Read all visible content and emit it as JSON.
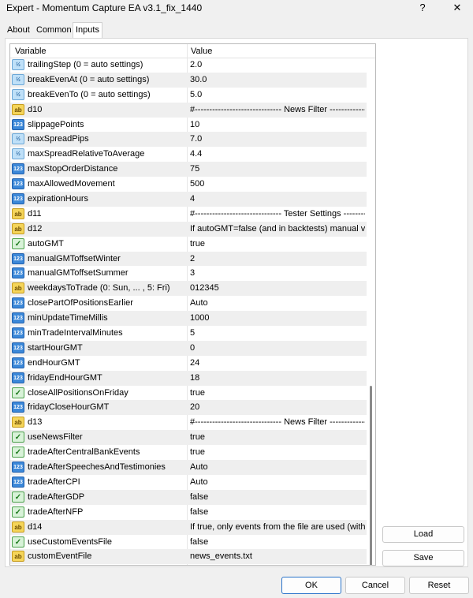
{
  "window": {
    "title": "Expert - Momentum Capture EA v3.1_fix_1440",
    "help_label": "?",
    "close_label": "✕"
  },
  "tabs": [
    {
      "label": "About"
    },
    {
      "label": "Common"
    },
    {
      "label": "Inputs"
    }
  ],
  "grid": {
    "col_variable": "Variable",
    "col_value": "Value",
    "rows": [
      {
        "name": "trailingStep (0 = auto settings)",
        "value": "2.0",
        "type": "dbl"
      },
      {
        "name": "breakEvenAt (0 = auto settings)",
        "value": "30.0",
        "type": "dbl"
      },
      {
        "name": "breakEvenTo (0 = auto settings)",
        "value": "5.0",
        "type": "dbl"
      },
      {
        "name": "d10",
        "value": "#------------------------------ News Filter ---------------------...",
        "type": "str"
      },
      {
        "name": "slippagePoints",
        "value": "10",
        "type": "num"
      },
      {
        "name": "maxSpreadPips",
        "value": "7.0",
        "type": "dbl"
      },
      {
        "name": "maxSpreadRelativeToAverage",
        "value": "4.4",
        "type": "dbl"
      },
      {
        "name": "maxStopOrderDistance",
        "value": "75",
        "type": "num"
      },
      {
        "name": "maxAllowedMovement",
        "value": "500",
        "type": "num"
      },
      {
        "name": "expirationHours",
        "value": "4",
        "type": "num"
      },
      {
        "name": "d11",
        "value": "#------------------------------ Tester Settings ------------------...",
        "type": "str"
      },
      {
        "name": "d12",
        "value": "If autoGMT=false (and in backtests) manual val...",
        "type": "str"
      },
      {
        "name": "autoGMT",
        "value": "true",
        "type": "bool"
      },
      {
        "name": "manualGMToffsetWinter",
        "value": "2",
        "type": "num"
      },
      {
        "name": "manualGMToffsetSummer",
        "value": "3",
        "type": "num"
      },
      {
        "name": "weekdaysToTrade (0: Sun, ... , 5: Fri)",
        "value": "012345",
        "type": "str"
      },
      {
        "name": "closePartOfPositionsEarlier",
        "value": "Auto",
        "type": "num"
      },
      {
        "name": "minUpdateTimeMillis",
        "value": "1000",
        "type": "num"
      },
      {
        "name": "minTradeIntervalMinutes",
        "value": "5",
        "type": "num"
      },
      {
        "name": "startHourGMT",
        "value": "0",
        "type": "num"
      },
      {
        "name": "endHourGMT",
        "value": "24",
        "type": "num"
      },
      {
        "name": "fridayEndHourGMT",
        "value": "18",
        "type": "num"
      },
      {
        "name": "closeAllPositionsOnFriday",
        "value": "true",
        "type": "bool"
      },
      {
        "name": "fridayCloseHourGMT",
        "value": "20",
        "type": "num"
      },
      {
        "name": "d13",
        "value": "#------------------------------ News Filter ---------------------...",
        "type": "str"
      },
      {
        "name": "useNewsFilter",
        "value": "true",
        "type": "bool"
      },
      {
        "name": "tradeAfterCentralBankEvents",
        "value": "true",
        "type": "bool"
      },
      {
        "name": "tradeAfterSpeechesAndTestimonies",
        "value": "Auto",
        "type": "num"
      },
      {
        "name": "tradeAfterCPI",
        "value": "Auto",
        "type": "num"
      },
      {
        "name": "tradeAfterGDP",
        "value": "false",
        "type": "bool"
      },
      {
        "name": "tradeAfterNFP",
        "value": "false",
        "type": "bool"
      },
      {
        "name": "d14",
        "value": "If true, only events from the file are used (withou...",
        "type": "str"
      },
      {
        "name": "useCustomEventsFile",
        "value": "false",
        "type": "bool"
      },
      {
        "name": "customEventFile",
        "value": "news_events.txt",
        "type": "str"
      }
    ]
  },
  "icons": {
    "num": "123",
    "dbl": "½",
    "str": "ab",
    "bool": "✓"
  },
  "buttons": {
    "load": "Load",
    "save": "Save",
    "ok": "OK",
    "cancel": "Cancel",
    "reset": "Reset"
  }
}
